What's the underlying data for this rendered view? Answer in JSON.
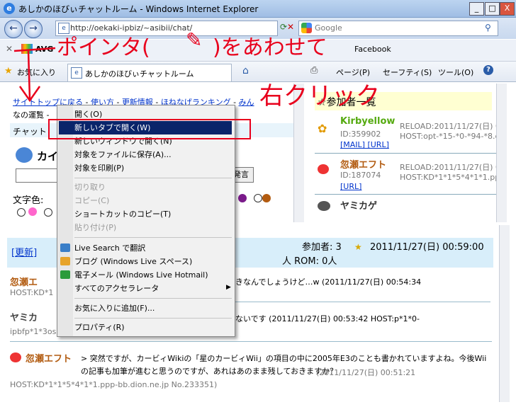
{
  "window": {
    "title": "あしかのほびぃチャットルーム - Windows Internet Explorer",
    "min": "_",
    "max": "□",
    "close": "X"
  },
  "nav": {
    "address": "http://oekaki-ipbiz/~asibii/chat/",
    "search_placeholder": "Google"
  },
  "toolbar": {
    "avg": "AVG",
    "facebook": "Facebook"
  },
  "favbar": {
    "favorites": "お気に入り",
    "tab_title": "あしかのほびぃチャットルーム",
    "page": "ページ(P)",
    "safety": "セーフティ(S)",
    "tools": "ツール(O)",
    "help": "?"
  },
  "chat": {
    "nav_links": [
      "サイトトップに戻る",
      "使い方",
      "更新情報",
      "ほねなげランキング",
      "みん"
    ],
    "nav2": "なの運覧 -",
    "chat_label": "チャット",
    "name_label": "カイ",
    "speak_button": "発言",
    "color_label": "文字色:"
  },
  "participants": {
    "header": "☆参加者一覧",
    "users": [
      {
        "name": "Kirbyellow",
        "id": "ID:359902",
        "links": "[MAIL] [URL]",
        "reload": "RELOAD:2011/11/27(日) 00",
        "host": "HOST:opt-*15-*0-*94-*8.c"
      },
      {
        "name": "忽瀬エフト",
        "id": "ID:187074",
        "links": "[URL]",
        "reload": "RELOAD:2011/11/27(日) 00",
        "host": "HOST:KD*1*1*5*4*1*1.ppp"
      },
      {
        "name": "ヤミカゲ"
      }
    ]
  },
  "log": {
    "refresh": "[更新]",
    "participants_count": "参加者: 3",
    "datetime": "2011/11/27(日) 00:59:00",
    "rom": "人  ROM: 0人",
    "msg1_name": "忽瀬エ",
    "msg1_text": "きなんでしょうけど…w (2011/11/27(日) 00:54:34",
    "msg1_host": "HOST:KD*1",
    "msg2_name": "ヤミカ",
    "msg2_text": "ないです (2011/11/27(日) 00:53:42 HOST:p*1*0-",
    "msg2_host": "ipbfp*1*3os",
    "msg3_name": "忽瀬エフト",
    "msg3_text": "> 突然ですが、カービィWikiの「星のカービィWii」の項目の中に2005年E3のことも書かれていますよね。今後Wiiの記事も加筆が進むと思うのですが、あれはあのまま残しておきますか？",
    "msg3_time": "(2011/11/27(日) 00:51:21",
    "msg3_host": "HOST:KD*1*1*5*4*1*1.ppp-bb.dion.ne.jp No.233351)"
  },
  "menu": {
    "items": [
      "開く(O)",
      "新しいタブで開く(W)",
      "新しいウィンドウで開く(N)",
      "対象をファイルに保存(A)...",
      "対象を印刷(P)",
      "切り取り",
      "コピー(C)",
      "ショートカットのコピー(T)",
      "貼り付け(P)",
      "Live Search で翻訳",
      "ブログ (Windows Live スペース)",
      "電子メール (Windows Live Hotmail)",
      "すべてのアクセラレータ",
      "お気に入りに追加(F)...",
      "プロパティ(R)"
    ]
  },
  "annotation": {
    "line1": "ポインタ(",
    "line1b": ")をあわせて",
    "line2": "右クリック"
  }
}
